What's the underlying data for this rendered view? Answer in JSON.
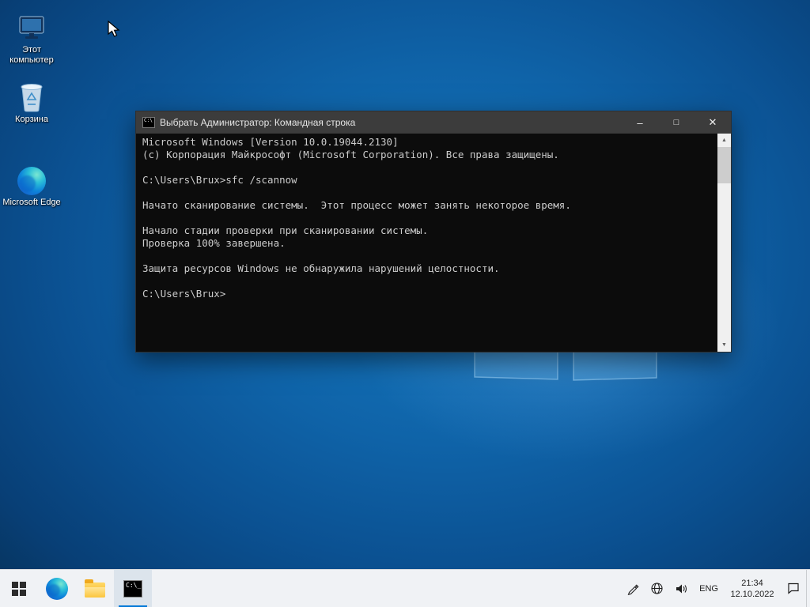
{
  "desktop": {
    "icons": [
      {
        "label": "Этот компьютер"
      },
      {
        "label": "Корзина"
      },
      {
        "label": "Microsoft Edge"
      }
    ]
  },
  "cmd_window": {
    "title": "Выбрать Администратор: Командная строка",
    "controls": {
      "minimize": "–",
      "maximize": "□",
      "close": "✕"
    },
    "console_lines": [
      "Microsoft Windows [Version 10.0.19044.2130]",
      "(c) Корпорация Майкрософт (Microsoft Corporation). Все права защищены.",
      "",
      "C:\\Users\\Brux>sfc /scannow",
      "",
      "Начато сканирование системы.  Этот процесс может занять некоторое время.",
      "",
      "Начало стадии проверки при сканировании системы.",
      "Проверка 100% завершена.",
      "",
      "Защита ресурсов Windows не обнаружила нарушений целостности.",
      "",
      "C:\\Users\\Brux>"
    ],
    "scrollbar": {
      "up": "▲",
      "down": "▼"
    },
    "titlebar_icon_text": "C:\\"
  },
  "taskbar": {
    "cmd_tile_text": "C:\\_",
    "language": "ENG",
    "time": "21:34",
    "date": "12.10.2022"
  },
  "colors": {
    "desktop_blue": "#0f63a8",
    "console_bg": "#0c0c0c",
    "titlebar_bg": "#3c3c3c",
    "taskbar_bg": "#f0f2f5",
    "accent": "#0078d7"
  }
}
